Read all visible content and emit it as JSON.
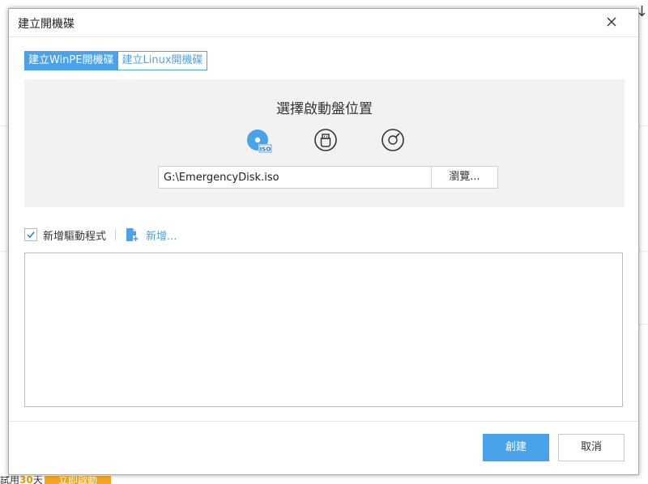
{
  "dialog": {
    "title": "建立開機碟"
  },
  "tabs": [
    {
      "label": "建立WinPE開機碟",
      "active": true
    },
    {
      "label": "建立Linux開機碟",
      "active": false
    }
  ],
  "location": {
    "heading": "選擇啟動盤位置",
    "media": [
      {
        "name": "iso-disc-icon",
        "selected": true,
        "badge": "ISO"
      },
      {
        "name": "usb-drive-icon",
        "selected": false
      },
      {
        "name": "cd-dvd-icon",
        "selected": false
      }
    ],
    "path_value": "G:\\EmergencyDisk.iso",
    "browse_label": "瀏覽..."
  },
  "drivers": {
    "checkbox_label": "新增驅動程式",
    "checked": true,
    "add_label": "新增...",
    "items": []
  },
  "footer": {
    "create_label": "創建",
    "cancel_label": "取消"
  },
  "background": {
    "corner_glyph": "↓",
    "trial_prefix": "試用",
    "trial_days": "30",
    "trial_suffix": "天",
    "activate_label": "立即啟動"
  },
  "colors": {
    "accent": "#4aa3ea",
    "panel_bg": "#f2f2f2",
    "activate_bg": "#f5a623"
  }
}
